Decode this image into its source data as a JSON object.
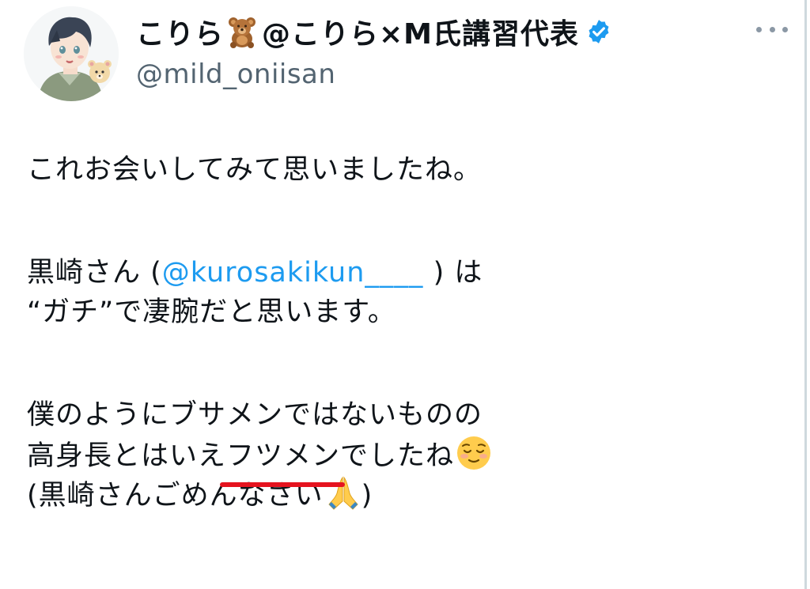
{
  "author": {
    "display_name": "こりら",
    "display_name_suffix": "@こりら×M氏講習代表",
    "handle": "@mild_oniisan",
    "name_emoji": "teddy-bear-icon",
    "verified": true
  },
  "colors": {
    "verified": "#1d9bf0",
    "mention": "#1d9bf0",
    "annotation_underline": "#e5131f"
  },
  "tweet": {
    "line1": "これお会いしてみて思いましたね。",
    "line2_pre": "黒崎さん (",
    "line2_mention": "@kurosakikun____",
    "line2_post": " ) は",
    "line3": "“ガチ”で凄腕だと思います。",
    "line4": "僕のようにブサメンではないものの",
    "line5_pre": "高身長とはいえ",
    "line5_underlined": "フツメン",
    "line5_post": "でしたね",
    "line5_emoji": "relieved-face-icon",
    "line6_text": "(黒崎さんごめんなさい",
    "line6_emoji": "folded-hands-icon",
    "line6_close": ")"
  }
}
